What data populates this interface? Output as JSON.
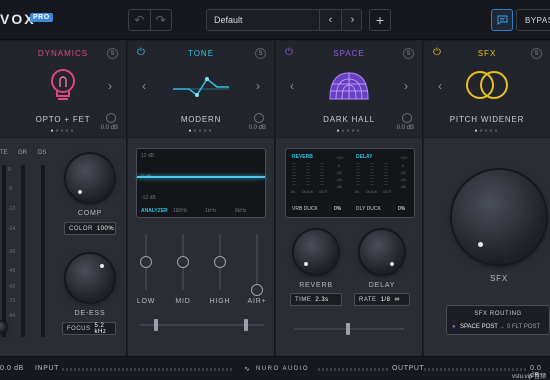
{
  "app": {
    "brand": "VOX",
    "badge": "PRO"
  },
  "header": {
    "undo": "↶",
    "redo": "↷",
    "preset_name": "Default",
    "prev": "‹",
    "next": "›",
    "add": "+",
    "bypass_label": "BYPASS"
  },
  "modules": [
    {
      "title": "DYNAMICS",
      "color": "#e0457b",
      "preset": "OPTO + FET",
      "gain": "0.0 dB",
      "solo": "S",
      "icon": "lightbulb-icon"
    },
    {
      "title": "TONE",
      "color": "#2fc1e0",
      "preset": "MODERN",
      "gain": "0.0 dB",
      "solo": "S",
      "icon": "eq-curve-icon"
    },
    {
      "title": "SPACE",
      "color": "#8f5ce8",
      "preset": "DARK HALL",
      "gain": "0.0 dB",
      "solo": "S",
      "icon": "dome-icon"
    },
    {
      "title": "SFX",
      "color": "#e6c020",
      "preset": "PITCH WIDENER",
      "gain": "",
      "solo": "S",
      "icon": "rings-icon"
    }
  ],
  "meters": {
    "headers": [
      "TE",
      "GR",
      "DS"
    ],
    "ticks": [
      "0",
      "-6",
      "-12",
      "-24",
      "-36",
      "-48",
      "-60",
      "-72",
      "-84"
    ]
  },
  "dynamics": {
    "comp_label": "COMP",
    "color_label": "COLOR",
    "color_value": "100%",
    "deess_label": "DE-ESS",
    "focus_label": "FOCUS",
    "focus_value": "5.2 kHz"
  },
  "tone": {
    "screen_label": "ANALYZER",
    "db_labels": [
      "12 dB",
      "0 dB",
      "-12 dB"
    ],
    "freq_labels": [
      "180Hz",
      "1kHz",
      "8kHz"
    ],
    "bands": [
      "LOW",
      "MID",
      "HIGH",
      "AIR+"
    ],
    "band_levels": [
      0.5,
      0.5,
      0.5,
      0.1
    ]
  },
  "space": {
    "reverb_meter_label": "REVERB",
    "delay_meter_label": "DELAY",
    "meter_cols": [
      "IN",
      "DUCK",
      "OUT"
    ],
    "meter_scale": [
      "+12",
      "0",
      "-12",
      "-24",
      "-36"
    ],
    "vrb_duck_label": "VRB DUCK",
    "vrb_duck_value": "0%",
    "dly_duck_label": "DLY DUCK",
    "dly_duck_value": "0%",
    "reverb_label": "REVERB",
    "delay_label": "DELAY",
    "time_label": "TIME",
    "time_value": "2.3s",
    "rate_label": "RATE",
    "rate_value": "1/8"
  },
  "sfx": {
    "knob_label": "SFX",
    "routing_label": "SFX ROUTING",
    "route_from": "SPACE POST",
    "route_arrow": "→",
    "route_to": "0 FLT POST"
  },
  "footer": {
    "input_value": "0.0 dB",
    "input_label": "INPUT",
    "logo": "NURO AUDIO",
    "output_label": "OUTPUT",
    "output_value": "0.0 dB"
  },
  "watermark": "vstu.vip 音频"
}
